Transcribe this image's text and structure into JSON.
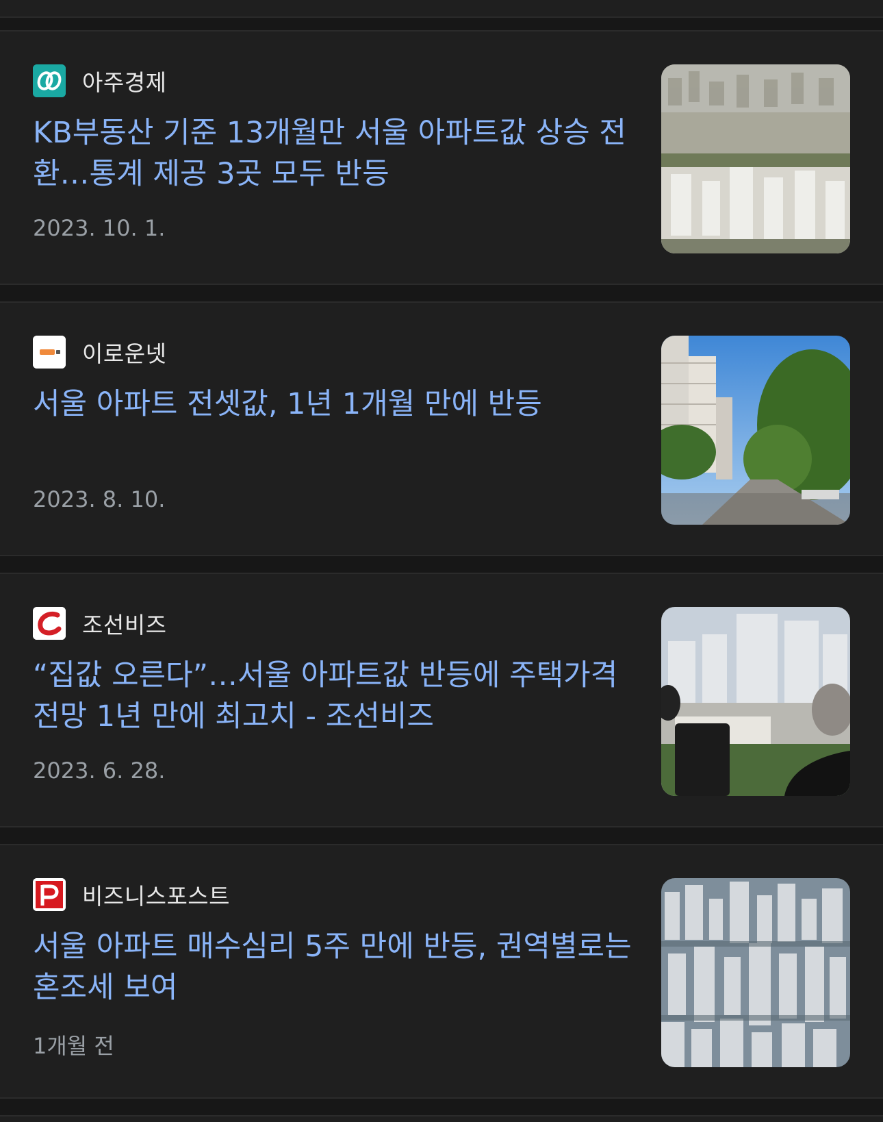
{
  "articles": [
    {
      "source": "아주경제",
      "title": "KB부동산 기준 13개월만 서울 아파트값 상승 전환…통계 제공 3곳 모두 반등",
      "date": "2023. 10. 1.",
      "favicon": "ajunews-logo-icon",
      "thumbnail": "apartment-city-photo"
    },
    {
      "source": "이로운넷",
      "title": "서울 아파트 전셋값, 1년 1개월 만에 반등",
      "date": "2023. 8. 10.",
      "favicon": "eroun-logo-icon",
      "thumbnail": "apartment-street-photo"
    },
    {
      "source": "조선비즈",
      "title": "“집값 오른다”…서울 아파트값 반등에 주택가격전망 1년 만에 최고치 - 조선비즈",
      "date": "2023. 6. 28.",
      "favicon": "chosunbiz-logo-icon",
      "thumbnail": "people-viewing-apartments-photo"
    },
    {
      "source": "비즈니스포스트",
      "title": "서울 아파트 매수심리 5주 만에 반등, 권역별로는 혼조세 보여",
      "date": "1개월 전",
      "favicon": "businesspost-logo-icon",
      "thumbnail": "dense-apartments-photo"
    }
  ]
}
